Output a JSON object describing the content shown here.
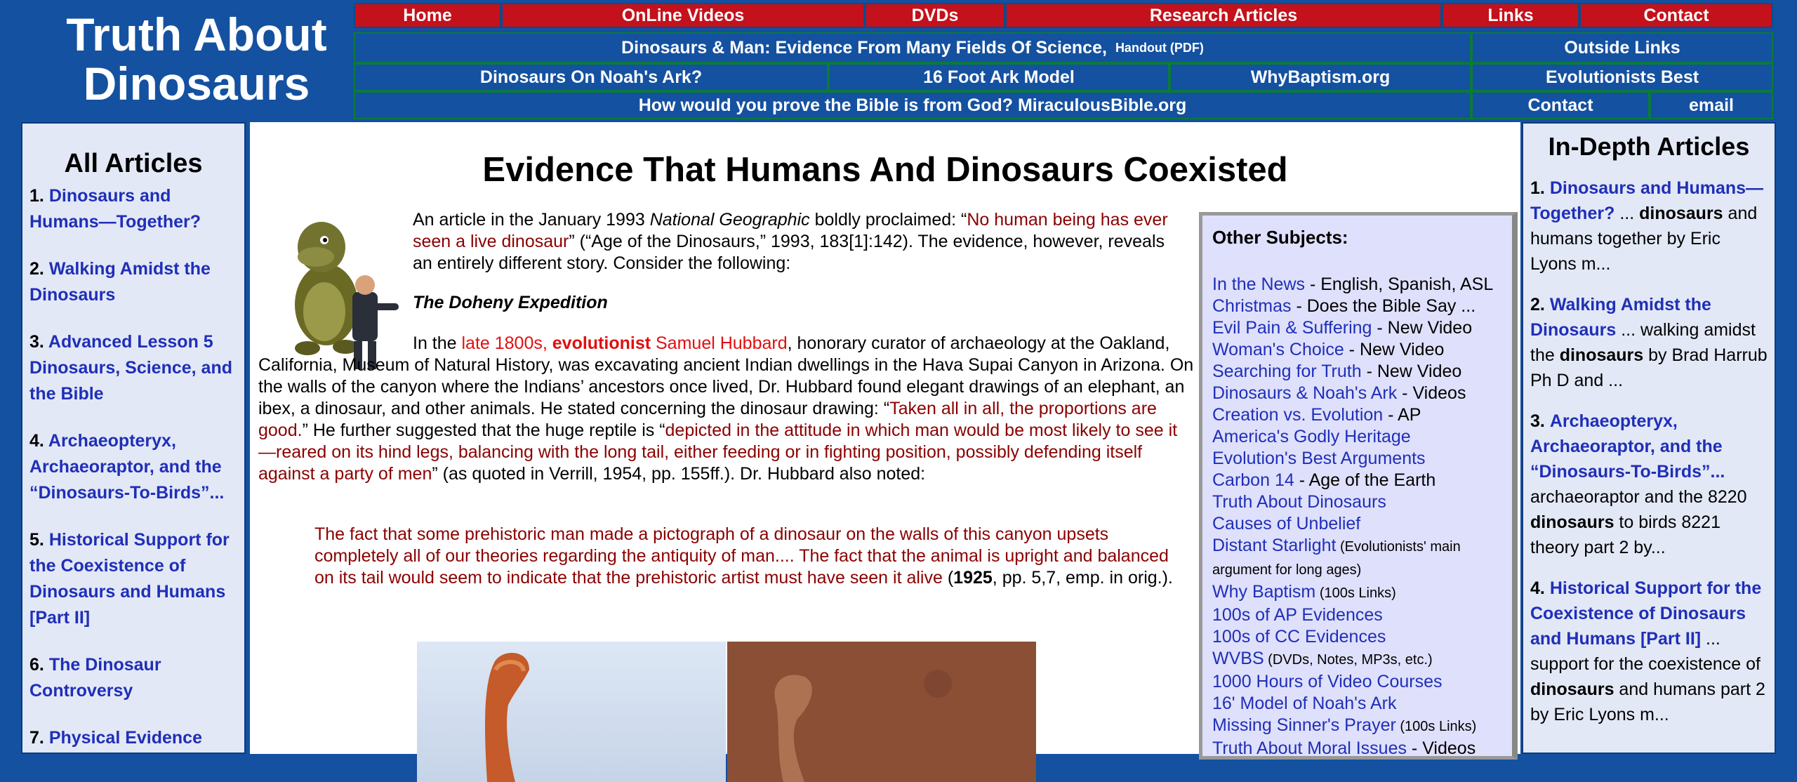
{
  "site": {
    "title_line1": "Truth About",
    "title_line2": "Dinosaurs"
  },
  "nav": {
    "row1": [
      "Home",
      "OnLine Videos",
      "DVDs",
      "Research Articles",
      "Links",
      "Contact"
    ],
    "row2_main": "Dinosaurs & Man: Evidence From Many Fields Of Science,",
    "row2_small": "Handout (PDF)",
    "row2_side": "Outside Links",
    "row3": [
      "Dinosaurs On Noah's Ark?",
      "16 Foot Ark Model",
      "WhyBaptism.org"
    ],
    "row3_side": "Evolutionists Best",
    "row4_main": "How would you prove the Bible is from God? MiraculousBible.org",
    "row4_side1": "Contact",
    "row4_side2": "email"
  },
  "left": {
    "heading": "All Articles",
    "items": [
      {
        "num": "1.",
        "label": "Dinosaurs and Humans—Together?"
      },
      {
        "num": "2.",
        "label": "Walking Amidst the Dinosaurs"
      },
      {
        "num": "3.",
        "label": "Advanced Lesson 5 Dinosaurs, Science, and the Bible"
      },
      {
        "num": "4.",
        "label": "Archaeopteryx, Archaeoraptor, and the “Dinosaurs-To-Birds”..."
      },
      {
        "num": "5.",
        "label": "Historical Support for the Coexistence of Dinosaurs and Humans [Part II]"
      },
      {
        "num": "6.",
        "label": "The Dinosaur Controversy"
      },
      {
        "num": "7.",
        "label": "Physical Evidence"
      }
    ]
  },
  "main": {
    "title": "Evidence That Humans And Dinosaurs Coexisted",
    "p1_a": "An article in the January 1993 ",
    "p1_b": "National Geographic",
    "p1_c": " boldly proclaimed: “",
    "p1_d": "No human being has ever seen a live dinosaur",
    "p1_e": "” (“Age of the Dinosaurs,” 1993, 183[1]:142). The evidence, however, reveals an entirely different story. Consider the following:",
    "sub": "The Doheny Expedition",
    "p2_a": "In the ",
    "p2_b": "late 1800s, ",
    "p2_c": "evolutionist",
    "p2_d": " Samuel Hubbard",
    "p2_e": ", honorary curator of archaeology at the Oakland, California, Museum of Natural History, was excavating ancient Indian dwellings in the Hava Supai Canyon in Arizona. On the walls of the canyon where the Indians’ ancestors once lived, Dr. Hubbard found elegant drawings of an elephant, an ibex, a dinosaur, and other animals. He stated concerning the dinosaur drawing: “",
    "p2_f": "Taken all in all, the proportions are good.",
    "p2_g": "” He further suggested that the huge reptile is “",
    "p2_h": "depicted in the attitude in which man would be most likely to see it—reared on its hind legs, balancing with the long tail, either feeding or in fighting position, possibly defending itself against a party of men",
    "p2_i": "” (as quoted in Verrill, 1954, pp. 155ff.). Dr. Hubbard also noted:",
    "q_a": "The fact that some prehistoric man made a pictograph of a dinosaur on the walls of this canyon upsets completely all of our theories regarding the antiquity of man.... The fact that the animal is upright and balanced on its tail would seem to indicate that the prehistoric artist must have seen it alive",
    "q_b": " (",
    "q_c": "1925",
    "q_d": ", pp. 5,7, emp. in orig.)."
  },
  "other": {
    "heading": "Other Subjects:",
    "items": [
      {
        "link": "In the News",
        "rest": " - English, Spanish, ASL",
        "small": ""
      },
      {
        "link": "Christmas",
        "rest": " - Does the Bible Say ...",
        "small": ""
      },
      {
        "link": "Evil Pain & Suffering",
        "rest": " - New Video",
        "small": ""
      },
      {
        "link": "Woman's Choice",
        "rest": " - New Video",
        "small": ""
      },
      {
        "link": "Searching for Truth",
        "rest": " - New Video",
        "small": ""
      },
      {
        "link": "Dinosaurs & Noah's Ark",
        "rest": " - Videos",
        "small": ""
      },
      {
        "link": "Creation vs. Evolution",
        "rest": " - AP",
        "small": ""
      },
      {
        "link": "America's Godly Heritage",
        "rest": "",
        "small": ""
      },
      {
        "link": "Evolution's Best Arguments",
        "rest": "",
        "small": ""
      },
      {
        "link": "Carbon 14",
        "rest": " - Age of the Earth",
        "small": ""
      },
      {
        "link": "Truth About Dinosaurs",
        "rest": "",
        "small": ""
      },
      {
        "link": "Causes of Unbelief",
        "rest": "",
        "small": ""
      },
      {
        "link": "Distant Starlight",
        "rest": "",
        "small": " (Evolutionists' main argument for long ages)"
      },
      {
        "link": "Why Baptism",
        "rest": "",
        "small": " (100s Links)"
      },
      {
        "link": "100s of AP Evidences",
        "rest": "",
        "small": ""
      },
      {
        "link": "100s of CC Evidences",
        "rest": "",
        "small": ""
      },
      {
        "link": "WVBS",
        "rest": "",
        "small": " (DVDs, Notes, MP3s, etc.)"
      },
      {
        "link": "1000 Hours of Video Courses",
        "rest": "",
        "small": ""
      },
      {
        "link": "16' Model of Noah's Ark",
        "rest": "",
        "small": ""
      },
      {
        "link": "Missing Sinner's Prayer",
        "rest": "",
        "small": " (100s Links)"
      },
      {
        "link": "Truth About Moral Issues",
        "rest": " - Videos",
        "small": ""
      }
    ]
  },
  "right": {
    "heading": "In-Depth Articles",
    "items": [
      {
        "num": "1.",
        "title": "Dinosaurs and Humans—Together?",
        "a": " ... ",
        "b": "dinosaurs",
        "c": " and humans together by Eric Lyons m..."
      },
      {
        "num": "2.",
        "title": "Walking Amidst the Dinosaurs",
        "a": " ... walking amidst the ",
        "b": "dinosaurs",
        "c": " by Brad Harrub Ph D and ..."
      },
      {
        "num": "3.",
        "title": "Archaeopteryx, Archaeoraptor, and the “Dinosaurs-To-Birds”...",
        "a": " archaeoraptor and the 8220 ",
        "b": "dinosaurs",
        "c": " to birds 8221 theory part 2 by..."
      },
      {
        "num": "4.",
        "title": "Historical Support for the Coexistence of Dinosaurs and Humans [Part II]",
        "a": " ... support for the coexistence of ",
        "b": "dinosaurs",
        "c": " and humans part 2 by Eric Lyons m..."
      }
    ]
  }
}
